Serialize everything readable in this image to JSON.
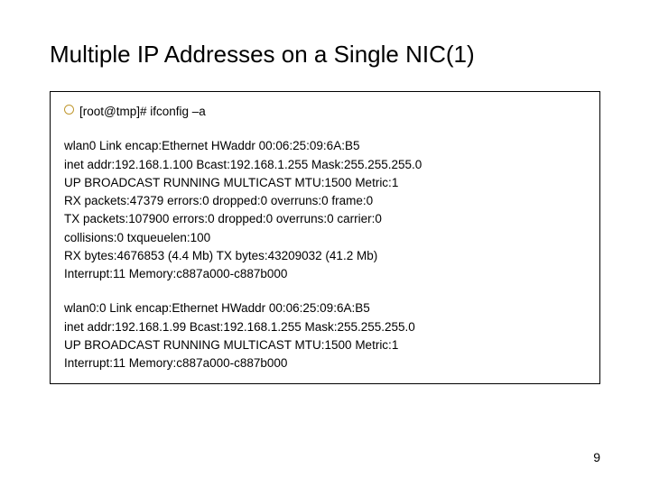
{
  "title": "Multiple IP Addresses on a Single NIC(1)",
  "prompt": "[root@tmp]# ifconfig –a",
  "block1": {
    "l0": "wlan0 Link encap:Ethernet HWaddr 00:06:25:09:6A:B5",
    "l1": "inet addr:192.168.1.100 Bcast:192.168.1.255 Mask:255.255.255.0",
    "l2": "UP BROADCAST RUNNING MULTICAST MTU:1500 Metric:1",
    "l3": "RX packets:47379 errors:0 dropped:0 overruns:0 frame:0",
    "l4": "TX packets:107900 errors:0 dropped:0 overruns:0 carrier:0",
    "l5": "collisions:0 txqueuelen:100",
    "l6": "RX bytes:4676853 (4.4 Mb) TX bytes:43209032 (41.2 Mb)",
    "l7": "Interrupt:11 Memory:c887a000-c887b000"
  },
  "block2": {
    "l0": "wlan0:0 Link encap:Ethernet HWaddr 00:06:25:09:6A:B5",
    "l1": "inet addr:192.168.1.99 Bcast:192.168.1.255 Mask:255.255.255.0",
    "l2": "UP BROADCAST RUNNING MULTICAST MTU:1500 Metric:1",
    "l3": "Interrupt:11 Memory:c887a000-c887b000"
  },
  "page_number": "9"
}
